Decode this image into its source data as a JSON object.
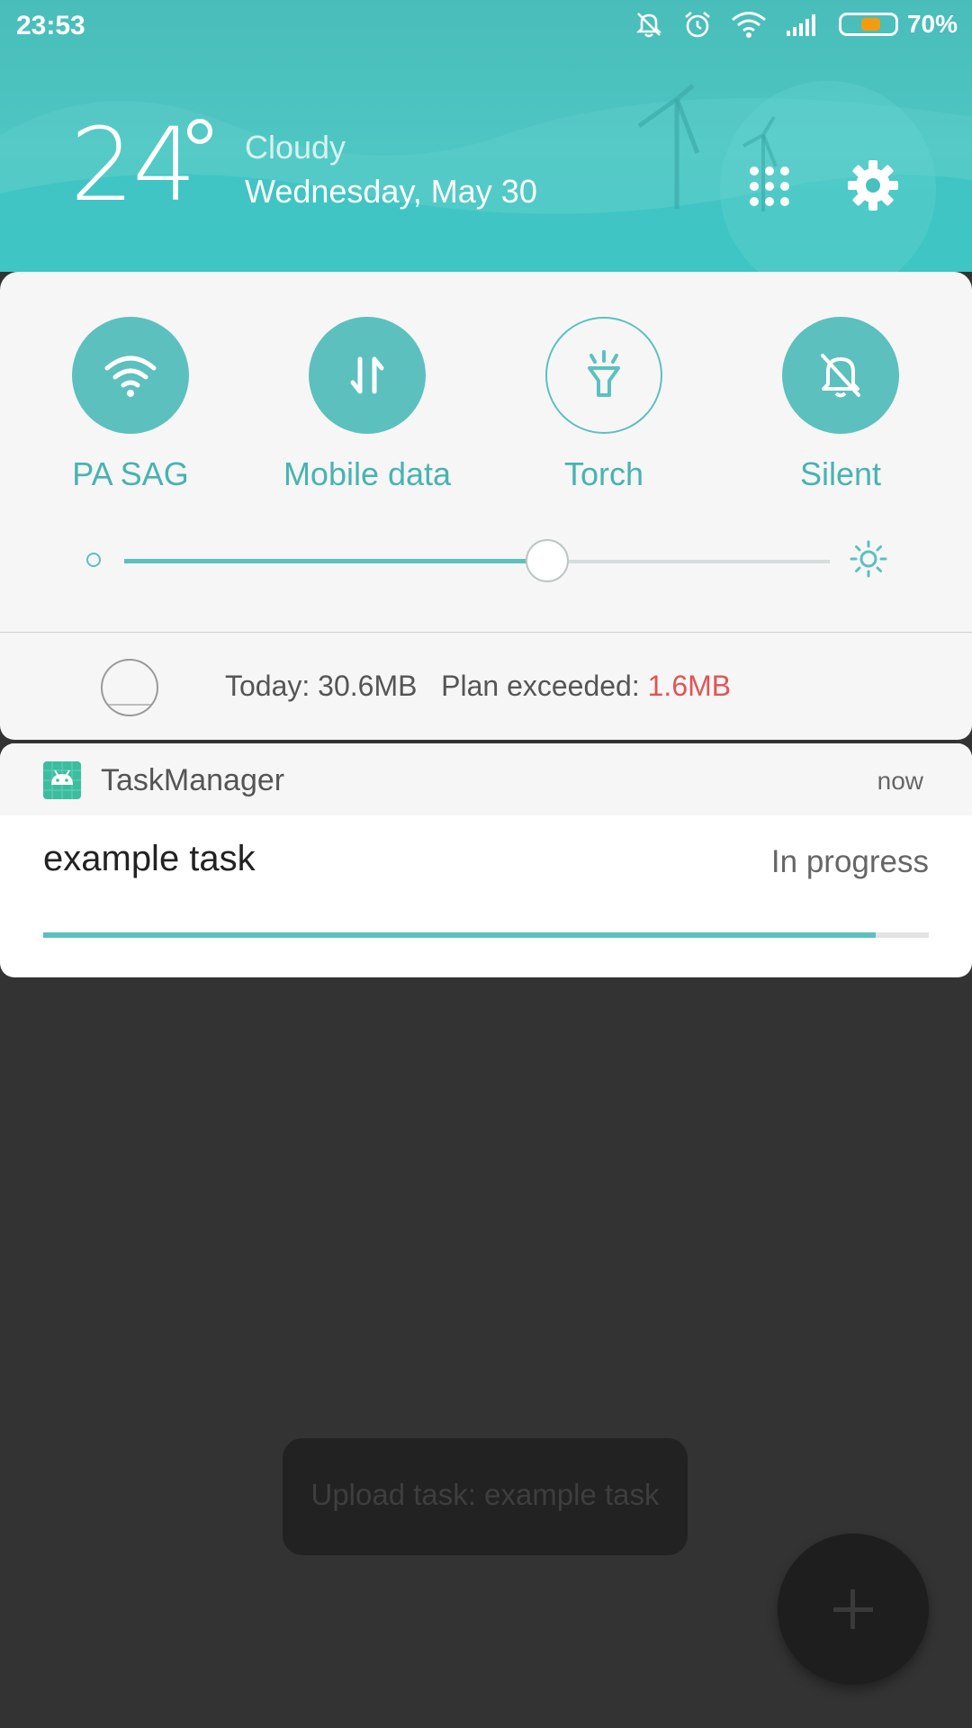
{
  "status_bar": {
    "time": "23:53",
    "icons": [
      "mute-icon",
      "alarm-icon",
      "wifi-icon",
      "signal-icon",
      "battery-icon"
    ],
    "battery_percent_text": "70%",
    "battery_level": 0.7,
    "battery_color": "#f39c12"
  },
  "weather": {
    "temperature": "24",
    "condition": "Cloudy",
    "date": "Wednesday, May 30"
  },
  "header_actions": {
    "apps_grid_icon": "grid-icon",
    "settings_icon": "gear-icon"
  },
  "quick_settings": {
    "accent_color": "#5cc0bf",
    "tiles": [
      {
        "label": "PA  SAG",
        "icon": "wifi-icon",
        "active": true
      },
      {
        "label": "Mobile data",
        "icon": "data-transfer-icon",
        "active": true
      },
      {
        "label": "Torch",
        "icon": "torch-icon",
        "active": false
      },
      {
        "label": "Silent",
        "icon": "bell-off-icon",
        "active": true
      }
    ],
    "brightness_level": 0.6
  },
  "data_usage": {
    "today_text": "Today: 30.6MB",
    "plan_text": "Plan exceeded: ",
    "exceeded_value": "1.6MB",
    "exceeded_color": "#e25454"
  },
  "notification": {
    "app_name": "TaskManager",
    "app_icon": "android-icon",
    "time": "now",
    "title": "example task",
    "status": "In progress",
    "progress": 0.94
  },
  "toast": {
    "text": "Upload task: example task"
  },
  "fab": {
    "icon": "plus-icon"
  }
}
